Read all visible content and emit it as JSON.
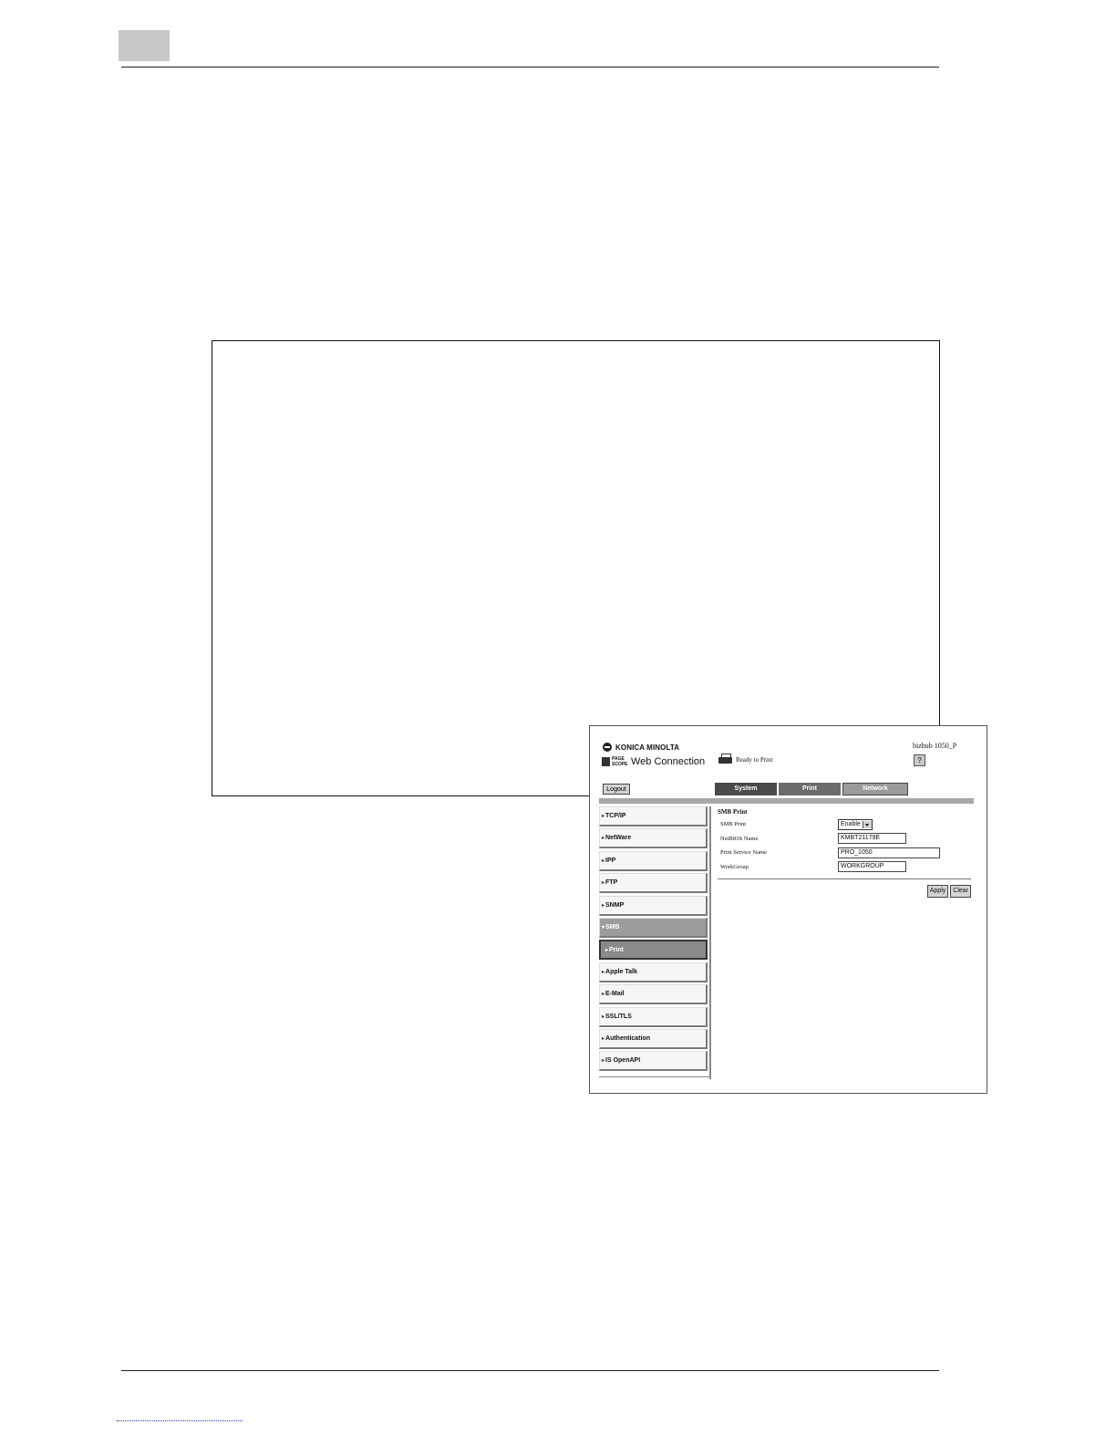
{
  "brand": {
    "company": "KONICA MINOLTA",
    "pagescope_line1": "PAGE",
    "pagescope_line2": "SCOPE",
    "product": "Web Connection"
  },
  "status": {
    "text": "Ready to Print"
  },
  "device": {
    "name": "bizhub 1050_P",
    "help_label": "?"
  },
  "toolbar": {
    "logout_label": "Logout"
  },
  "tabs": [
    "System",
    "Print",
    "Network"
  ],
  "sidebar": {
    "items": [
      {
        "label": "TCP/IP"
      },
      {
        "label": "NetWare"
      },
      {
        "label": "IPP"
      },
      {
        "label": "FTP"
      },
      {
        "label": "SNMP"
      },
      {
        "label": "SMB"
      },
      {
        "label": "Print"
      },
      {
        "label": "Apple Talk"
      },
      {
        "label": "E-Mail"
      },
      {
        "label": "SSL/TLS"
      },
      {
        "label": "Authentication"
      },
      {
        "label": "IS OpenAPI"
      }
    ]
  },
  "content": {
    "title": "SMB Print",
    "fields": {
      "smb_print": {
        "label": "SMB Print",
        "value": "Enable"
      },
      "netbios": {
        "label": "NetBIOS Name",
        "value": "KMBT21179E"
      },
      "service": {
        "label": "Print Service Name",
        "value": "PRO_1050"
      },
      "workgroup": {
        "label": "WorkGroup",
        "value": "WORKGROUP"
      }
    },
    "apply_label": "Apply",
    "clear_label": "Clear"
  }
}
